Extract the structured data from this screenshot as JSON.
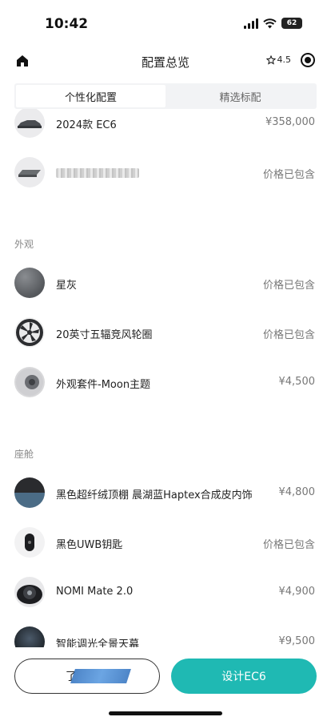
{
  "status": {
    "time": "10:42",
    "battery": "62"
  },
  "nav": {
    "title": "配置总览",
    "rating": "4.5"
  },
  "tabs": [
    {
      "label": "个性化配置",
      "active": true
    },
    {
      "label": "精选标配",
      "active": false
    }
  ],
  "model": [
    {
      "name": "2024款 EC6",
      "price": "¥358,000",
      "thumb": "car-icon"
    },
    {
      "name": "",
      "price": "价格已包含",
      "thumb": "battery-pack-icon"
    }
  ],
  "exterior": {
    "label": "外观",
    "items": [
      {
        "name": "星灰",
        "price": "价格已包含",
        "thumb": "paint-swatch-icon",
        "color": "#5c5f63"
      },
      {
        "name": "20英寸五辐竞风轮圈",
        "price": "价格已包含",
        "thumb": "wheel-icon"
      },
      {
        "name": "外观套件-Moon主题",
        "price": "¥4,500",
        "thumb": "kit-icon"
      }
    ]
  },
  "cabin": {
    "label": "座舱",
    "items": [
      {
        "name": "黑色超纤绒顶棚 晨湖蓝Haptex合成皮内饰",
        "price": "¥4,800",
        "thumb": "interior-icon"
      },
      {
        "name": "黑色UWB钥匙",
        "price": "价格已包含",
        "thumb": "key-icon"
      },
      {
        "name": "NOMI Mate 2.0",
        "price": "¥4,900",
        "thumb": "nomi-icon"
      },
      {
        "name": "智能调光全景天幕",
        "price": "¥9,500",
        "thumb": "sunroof-icon"
      }
    ]
  },
  "footer": {
    "left_button": "了",
    "right_button": "设计EC6"
  },
  "colors": {
    "accent": "#1fb9b3"
  }
}
